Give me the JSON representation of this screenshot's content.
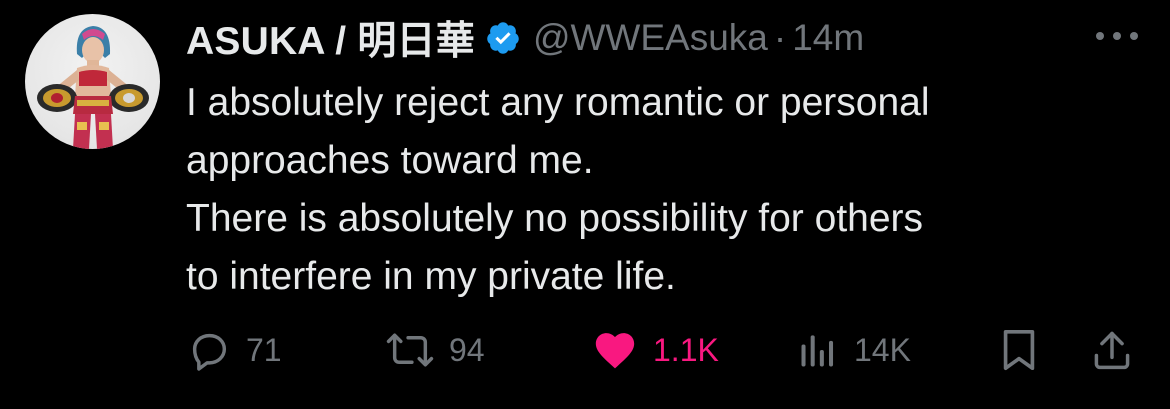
{
  "tweet": {
    "display_name": "ASUKA / 明日華",
    "handle": "@WWEAsuka",
    "separator": "·",
    "time": "14m",
    "lines": [
      "I absolutely reject any romantic or personal",
      "approaches toward me.",
      "There is absolutely no possibility for others",
      "to interfere in my private life."
    ]
  },
  "actions": {
    "replies": "71",
    "retweets": "94",
    "likes": "1.1K",
    "views": "14K"
  },
  "icons": {
    "verified": "verified-badge-icon",
    "more": "more-options-icon",
    "reply": "reply-icon",
    "retweet": "retweet-icon",
    "like": "heart-icon",
    "views": "views-chart-icon",
    "bookmark": "bookmark-icon",
    "share": "share-icon"
  },
  "colors": {
    "background": "#000000",
    "text": "#e7e9ea",
    "muted": "#71767b",
    "verified": "#1d9bf0",
    "like": "#f91880"
  }
}
